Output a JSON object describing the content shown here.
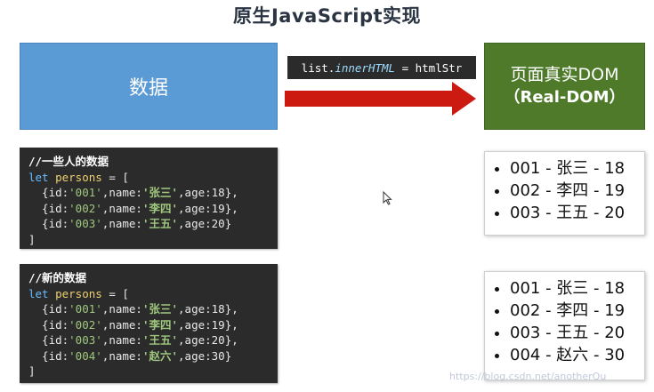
{
  "title": "原生JavaScript实现",
  "data_box": {
    "label": "数据"
  },
  "dom_box": {
    "line1": "页面真实DOM",
    "line2": "（Real-DOM）"
  },
  "arrow_code": {
    "left": "list.",
    "keyword": "innerHTML",
    "right": " = htmlStr"
  },
  "code1": {
    "comment": "//一些人的数据",
    "kw": "let",
    "var": "persons",
    "persons": [
      {
        "id": "001",
        "name": "张三",
        "age": "18"
      },
      {
        "id": "002",
        "name": "李四",
        "age": "19"
      },
      {
        "id": "003",
        "name": "王五",
        "age": "20"
      }
    ]
  },
  "code2": {
    "comment": "//新的数据",
    "kw": "let",
    "var": "persons",
    "persons": [
      {
        "id": "001",
        "name": "张三",
        "age": "18"
      },
      {
        "id": "002",
        "name": "李四",
        "age": "19"
      },
      {
        "id": "003",
        "name": "王五",
        "age": "20"
      },
      {
        "id": "004",
        "name": "赵六",
        "age": "30"
      }
    ]
  },
  "list1": [
    "001 - 张三 - 18",
    "002 - 李四 - 19",
    "003 - 王五 - 20"
  ],
  "list2": [
    "001 - 张三 - 18",
    "002 - 李四 - 19",
    "003 - 王五 - 20",
    "004 - 赵六 - 30"
  ],
  "watermark": "https://blog.csdn.net/anotherQu",
  "colors": {
    "data_box": "#5b9bd5",
    "dom_box": "#4e7a2a",
    "arrow": "#cc1a10",
    "code_bg": "#2b2b2b"
  }
}
